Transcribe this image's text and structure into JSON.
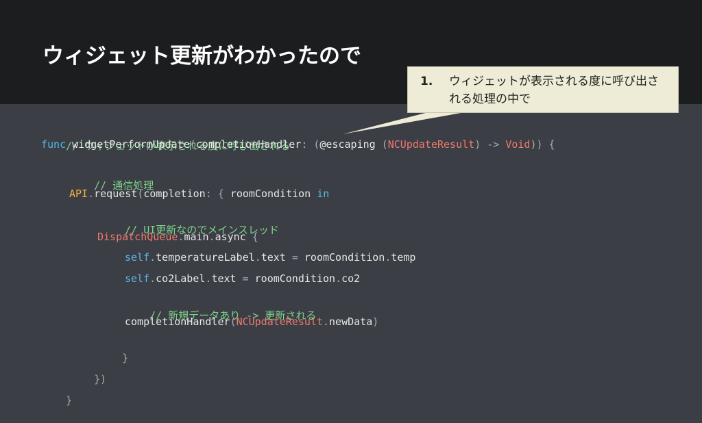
{
  "slide": {
    "title": "ウィジェット更新がわかったので"
  },
  "callout": {
    "number": "1.",
    "text": "ウィジェットが表示される度に呼び出される処理の中で"
  },
  "colors": {
    "header_bg": "#1c1d1f",
    "body_bg": "#3b3e44",
    "comment": "#7fd18b",
    "keyword": "#5ab7e8",
    "type": "#f27a6e",
    "api": "#f2b344",
    "callout_bg": "#eeecd6"
  },
  "code": {
    "l1_comment": "// ウィジェットが表示される度に呼び出される",
    "l2_func": "func",
    "l2_name": " widgetPerformUpdate",
    "l2_p1": "(",
    "l2_param": "completionHandler",
    "l2_p2": ": (",
    "l2_escaping": "@escaping",
    "l2_p3": " (",
    "l2_type1": "NCUpdateResult",
    "l2_p4": ") -> ",
    "l2_type2": "Void",
    "l2_p5": ")) {",
    "l3_comment": "// 通信処理",
    "l4_api": "API",
    "l4_p1": ".",
    "l4_request": "request",
    "l4_p2": "(",
    "l4_completion": "completion",
    "l4_p3": ": { ",
    "l4_room": "roomCondition",
    "l4_in": " in",
    "l5_comment": "// UI更新なのでメインスレッド",
    "l6_dq": "DispatchQueue",
    "l6_p1": ".",
    "l6_main": "main",
    "l6_p2": ".",
    "l6_async": "async",
    "l6_p3": " {",
    "l7_self": "self",
    "l7_p1": ".",
    "l7_label": "temperatureLabel",
    "l7_p2": ".",
    "l7_text": "text",
    "l7_p3": " = ",
    "l7_room": "roomCondition",
    "l7_p4": ".",
    "l7_temp": "temp",
    "l8_self": "self",
    "l8_p1": ".",
    "l8_label": "co2Label",
    "l8_p2": ".",
    "l8_text": "text",
    "l8_p3": " = ",
    "l8_room": "roomCondition",
    "l8_p4": ".",
    "l8_co2": "co2",
    "l9_comment": "// 新規データあり -> 更新される",
    "l10_handler": "completionHandler",
    "l10_p1": "(",
    "l10_type": "NCUpdateResult",
    "l10_p2": ".",
    "l10_newdata": "newData",
    "l10_p3": ")",
    "l11_close": "}",
    "l12_close": "})",
    "l13_close": "}"
  }
}
